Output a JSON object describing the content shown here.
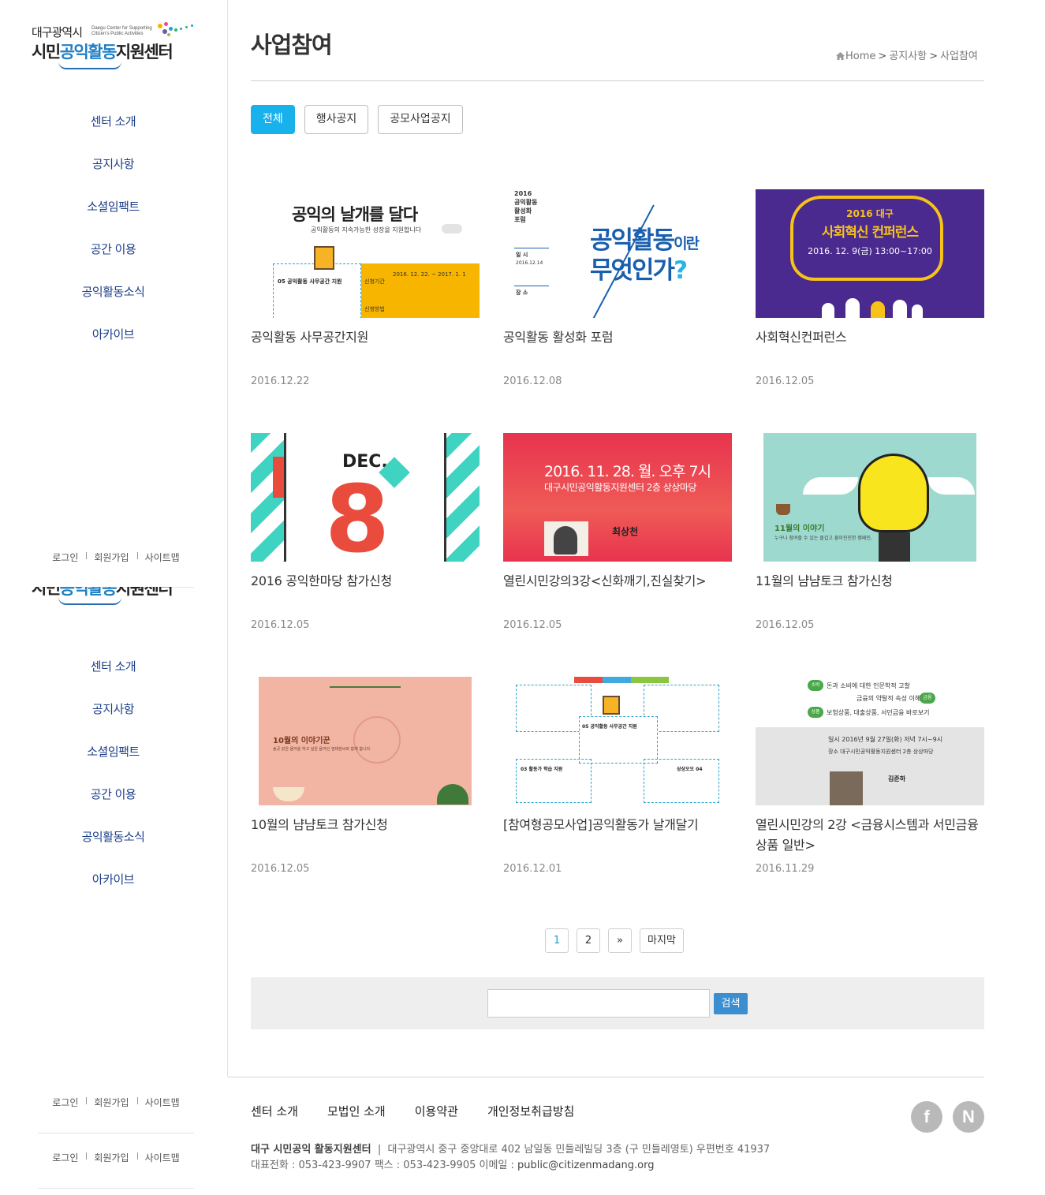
{
  "logo": {
    "line1": "대구광역시",
    "sub1": "Daegu Center for Supporting",
    "sub2": "Citizen's Public Activities",
    "line2_a": "시민",
    "line2_hl": "공익활동",
    "line2_b": "지원센터"
  },
  "sidebar": {
    "menu": [
      "센터 소개",
      "공지사항",
      "소셜임팩트",
      "공간 이용",
      "공익활동소식",
      "아카이브"
    ],
    "util": [
      "로그인",
      "회원가입",
      "사이트맵"
    ]
  },
  "page": {
    "title": "사업참여",
    "breadcrumb": [
      "Home",
      "공지사항",
      "사업참여"
    ]
  },
  "tabs": [
    {
      "label": "전체",
      "active": true
    },
    {
      "label": "행사공지",
      "active": false
    },
    {
      "label": "공모사업공지",
      "active": false
    }
  ],
  "posts": [
    {
      "title": "공익활동 사무공간지원",
      "date": "2016.12.22",
      "thumb": {
        "headline": "공익의 날개를 달다",
        "sub": "공익활동의 지속가능한 성장을 지원합니다",
        "box": "05 공익활동 사무공간 지원",
        "period": "2016. 12. 22. ~ 2017. 1. 1",
        "l1": "신청기간",
        "l2": "신청방법"
      }
    },
    {
      "title": "공익활동 활성화 포럼",
      "date": "2016.12.08",
      "thumb": {
        "side1": "2016",
        "side2": "공익활동",
        "side3": "활성화",
        "side4": "포럼",
        "when_label": "일 시",
        "when": "2016.12.14",
        "where_label": "장 소",
        "big1": "공익활동",
        "big1b": "이란",
        "big2": "무엇인가",
        "q": "?"
      }
    },
    {
      "title": "사회혁신컨퍼런스",
      "date": "2016.12.05",
      "thumb": {
        "t1": "2016 대구",
        "t2": "사회혁신 컨퍼런스",
        "t3": "2016. 12. 9(금) 13:00~17:00"
      }
    },
    {
      "title": "2016 공익한마당 참가신청",
      "date": "2016.12.05",
      "thumb": {
        "month": "DEC.",
        "day": "8"
      }
    },
    {
      "title": "열린시민강의3강<신화깨기,진실찾기>",
      "date": "2016.12.05",
      "thumb": {
        "t1": "2016. 11. 28. 월. 오후 7시",
        "t2": "대구시민공익활동지원센터 2층 상상마당",
        "t3": "최상천"
      }
    },
    {
      "title": "11월의 냠냠토크 참가신청",
      "date": "2016.12.05",
      "thumb": {
        "t1": "11월의 이야기",
        "t2": "누구나 참여할 수 있는 즐겁고 흥미진진한 캠페인,"
      }
    },
    {
      "title": "10월의 냠냠토크 참가신청",
      "date": "2016.12.05",
      "thumb": {
        "t1": "10월의 이야기꾼",
        "t2": "송곳 같은 음악을 하고 싶은 음악인 엄태현씨와 함께 합니다."
      }
    },
    {
      "title": "[참여형공모사업]공익활동가 날개달기",
      "date": "2016.12.01",
      "thumb": {
        "b1": "05 공익활동 사무공간 지원",
        "b2": "03 활동가 학습 지원",
        "b3": "상상오오 04"
      }
    },
    {
      "title": "열린시민강의 2강 <금융시스템과 서민금융 상품 일반>",
      "date": "2016.11.29",
      "thumb": {
        "t1": "돈과 소비에 대한 인문학적 고찰",
        "t2": "금융의 약탈적 속성 이해",
        "t3": "보험상품, 대출상품, 서민금융 바로보기",
        "t4": "일시 2016년 9월 27일(화) 저녁 7시~9시",
        "t5": "장소 대구시민공익활동지원센터 2층 상상마당",
        "t6": "김준하",
        "c1": "소비",
        "c2": "금융",
        "c3": "상품"
      }
    }
  ],
  "pagination": [
    "1",
    "2",
    "»",
    "마지막"
  ],
  "search": {
    "button": "검색",
    "value": ""
  },
  "footer": {
    "links": [
      "센터 소개",
      "모법인 소개",
      "이용약관",
      "개인정보취급방침"
    ],
    "org": "대구 시민공익 활동지원센터",
    "address": "대구광역시 중구 중앙대로 402 남일동 민들레빌딩 3층 (구 민들레영토) 우편번호 41937",
    "contact": "대표전화 : 053-423-9907 팩스 : 053-423-9905 이메일 : ",
    "email": "public@citizenmadang.org",
    "social": [
      "facebook",
      "naver"
    ],
    "social_text": [
      "f",
      "N"
    ]
  },
  "colors": {
    "accent": "#19b1ec",
    "menu": "#1c3f8a",
    "search_btn": "#3b8ed0"
  }
}
